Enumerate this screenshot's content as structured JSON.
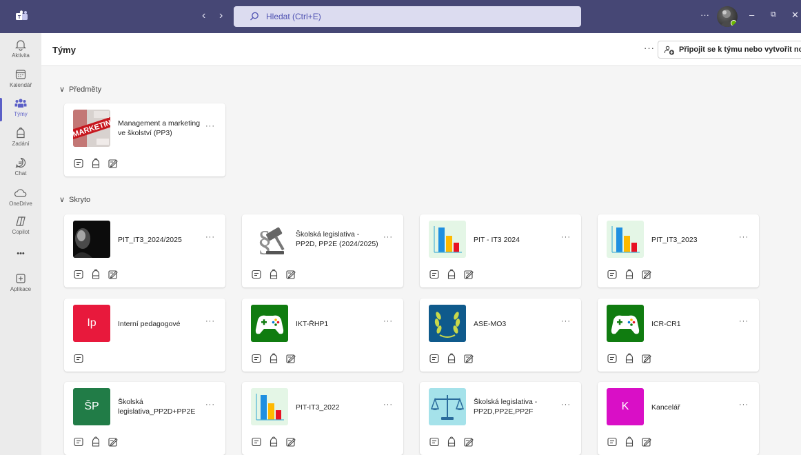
{
  "titlebar": {
    "back_icon": "chevron-left-icon",
    "forward_icon": "chevron-right-icon",
    "search_placeholder": "Hledat (Ctrl+E)",
    "more": "···",
    "minimize": "–",
    "restore": "⧉",
    "close": "✕"
  },
  "rail": {
    "items": [
      {
        "label": "Aktivita",
        "icon": "bell-icon"
      },
      {
        "label": "Kalendář",
        "icon": "calendar-icon"
      },
      {
        "label": "Týmy",
        "icon": "teams-icon",
        "active": true
      },
      {
        "label": "Zadání",
        "icon": "backpack-icon"
      },
      {
        "label": "Chat",
        "icon": "chat-icon"
      },
      {
        "label": "OneDrive",
        "icon": "cloud-icon"
      },
      {
        "label": "Copilot",
        "icon": "copilot-icon"
      },
      {
        "label": "•••",
        "icon": "more-icon"
      },
      {
        "label": "Aplikace",
        "icon": "add-apps-icon"
      }
    ]
  },
  "header": {
    "title": "Týmy",
    "more": "···",
    "join_button": "Připojit se k týmu nebo vytvořit nový"
  },
  "sections": [
    {
      "title": "Předměty",
      "chevron": "∨"
    },
    {
      "title": "Skryto",
      "chevron": "∨"
    }
  ],
  "teams": [
    {
      "name": "Management a marketing ve školství (PP3)",
      "thumb": "marketing-photo"
    },
    {
      "name": "PIT_IT3_2024/2025",
      "thumb": "portrait-photo"
    },
    {
      "name": "Školská legislativa - PP2D, PP2E (2024/2025)",
      "thumb": "gavel-photo"
    },
    {
      "name": "PIT - IT3 2024",
      "thumb": "bar-chart"
    },
    {
      "name": "PIT_IT3_2023",
      "thumb": "bar-chart"
    },
    {
      "name": "Interní pedagogové",
      "initials": "Ip",
      "color": "#e8193c"
    },
    {
      "name": "IKT-ŘHP1",
      "thumb": "gamepad"
    },
    {
      "name": "ASE-MO3",
      "thumb": "laurel"
    },
    {
      "name": "ICR-CR1",
      "thumb": "gamepad"
    },
    {
      "name": "Školská legislativa_PP2D+PP2E",
      "initials": "ŠP",
      "color": "#217c47"
    },
    {
      "name": "PIT-IT3_2022",
      "thumb": "bar-chart"
    },
    {
      "name": "Školská legislativa - PP2D,PP2E,PP2F",
      "thumb": "scales"
    },
    {
      "name": "Kancelář",
      "initials": "K",
      "color": "#d90fc6"
    }
  ],
  "card_more": "···",
  "colors": {
    "titlebar": "#464775",
    "accent": "#5b5fc7"
  }
}
